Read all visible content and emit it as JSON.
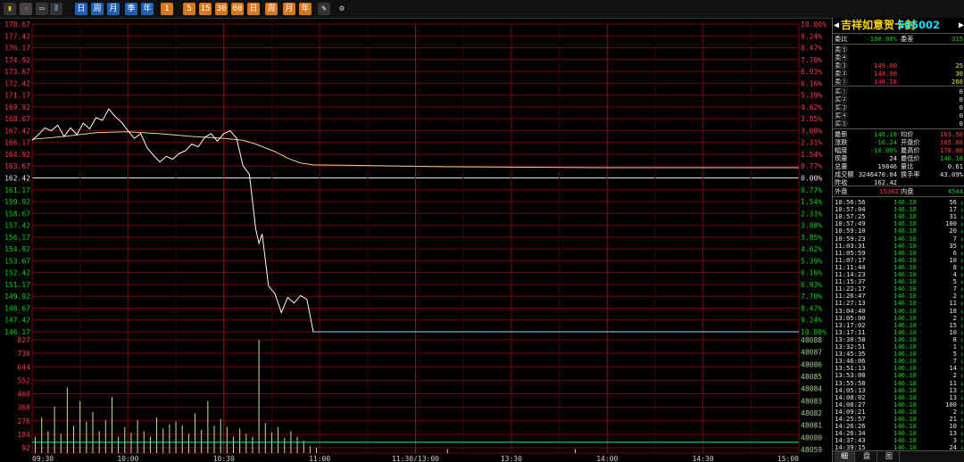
{
  "toolbar": {
    "buttons": [
      {
        "name": "bar-chart-icon",
        "glyph": "▮",
        "bg": "#333",
        "color": "#e8c000"
      },
      {
        "name": "line-chart-icon",
        "glyph": "↗",
        "bg": "#444",
        "color": "#ff4040"
      },
      {
        "name": "window-icon",
        "glyph": "▭",
        "bg": "#333",
        "color": "#ddd"
      },
      {
        "name": "candles-icon",
        "glyph": "⫴",
        "bg": "#333",
        "color": "#6cf"
      },
      {
        "name": "tool-1-icon",
        "glyph": "日",
        "bg": "#1e5fb8",
        "color": "#fff"
      },
      {
        "name": "tool-2-icon",
        "glyph": "周",
        "bg": "#1e5fb8",
        "color": "#fff"
      },
      {
        "name": "tool-3-icon",
        "glyph": "月",
        "bg": "#1e5fb8",
        "color": "#fff"
      },
      {
        "name": "tool-4-icon",
        "glyph": "季",
        "bg": "#1e5fb8",
        "color": "#fff"
      },
      {
        "name": "tool-5-icon",
        "glyph": "年",
        "bg": "#1e5fb8",
        "color": "#fff"
      },
      {
        "name": "period-1-icon",
        "glyph": "1",
        "bg": "#d9781a",
        "color": "#fff"
      },
      {
        "name": "period-5-icon",
        "glyph": "5",
        "bg": "#d9781a",
        "color": "#fff"
      },
      {
        "name": "period-15-icon",
        "glyph": "15",
        "bg": "#d9781a",
        "color": "#fff"
      },
      {
        "name": "period-30-icon",
        "glyph": "30",
        "bg": "#d9781a",
        "color": "#fff"
      },
      {
        "name": "period-60-icon",
        "glyph": "60",
        "bg": "#d9781a",
        "color": "#fff"
      },
      {
        "name": "period-d-icon",
        "glyph": "日",
        "bg": "#d9781a",
        "color": "#fff"
      },
      {
        "name": "period-w-icon",
        "glyph": "周",
        "bg": "#d9781a",
        "color": "#fff"
      },
      {
        "name": "period-m-icon",
        "glyph": "月",
        "bg": "#d9781a",
        "color": "#fff"
      },
      {
        "name": "period-y-icon",
        "glyph": "年",
        "bg": "#d9781a",
        "color": "#fff"
      },
      {
        "name": "draw-pen-icon",
        "glyph": "✎",
        "bg": "#333",
        "color": "#fff"
      },
      {
        "name": "gear-icon",
        "glyph": "⚙",
        "bg": "#111",
        "color": "#ddd"
      }
    ]
  },
  "colors": {
    "up": "#ff3b3b",
    "down": "#00d000",
    "flat": "#e6e6e6",
    "price_line": "#ffffff",
    "avg_line": "#e8d48a",
    "volume": "#b8e8a0",
    "grid": "#7a0000",
    "ref_line": "#00ff99"
  },
  "chart_data": [
    {
      "type": "line",
      "prev_close": 162.42,
      "price_ticks_left": [
        "178.67",
        "177.42",
        "176.17",
        "174.92",
        "173.67",
        "172.42",
        "171.17",
        "169.92",
        "168.67",
        "167.42",
        "166.17",
        "164.92",
        "163.67",
        "162.42",
        "161.17",
        "159.92",
        "158.67",
        "157.42",
        "156.17",
        "154.92",
        "153.67",
        "152.42",
        "151.17",
        "149.92",
        "148.67",
        "147.42",
        "146.17"
      ],
      "pct_ticks_right": [
        "10.00%",
        "9.24%",
        "8.47%",
        "7.70%",
        "6.93%",
        "6.16%",
        "5.39%",
        "4.62%",
        "3.85%",
        "3.08%",
        "2.31%",
        "1.54%",
        "0.77%",
        "0.00%",
        "0.77%",
        "1.54%",
        "2.31%",
        "3.08%",
        "3.85%",
        "4.62%",
        "5.39%",
        "6.16%",
        "6.93%",
        "7.70%",
        "8.47%",
        "9.24%",
        "10.00%"
      ],
      "ylim": [
        146.17,
        178.67
      ],
      "x_labels": [
        "09:30",
        "10:00",
        "10:30",
        "11:00",
        "11:30/13:00",
        "13:30",
        "14:00",
        "14:30",
        "15:00"
      ],
      "total_minutes": 240,
      "price": [
        [
          0,
          166.4
        ],
        [
          2,
          167
        ],
        [
          4,
          167.7
        ],
        [
          6,
          167.4
        ],
        [
          8,
          168
        ],
        [
          10,
          166.8
        ],
        [
          12,
          167.7
        ],
        [
          14,
          167
        ],
        [
          16,
          168.2
        ],
        [
          18,
          167.6
        ],
        [
          20,
          168.8
        ],
        [
          22,
          168.5
        ],
        [
          24,
          169.7
        ],
        [
          26,
          168.9
        ],
        [
          28,
          168.3
        ],
        [
          30,
          167.4
        ],
        [
          32,
          166.6
        ],
        [
          34,
          167.1
        ],
        [
          36,
          165.6
        ],
        [
          38,
          164.8
        ],
        [
          40,
          164.1
        ],
        [
          42,
          164.7
        ],
        [
          44,
          164.4
        ],
        [
          46,
          165
        ],
        [
          48,
          165.3
        ],
        [
          50,
          166
        ],
        [
          52,
          165.7
        ],
        [
          54,
          166.7
        ],
        [
          56,
          167.1
        ],
        [
          58,
          166.3
        ],
        [
          60,
          167.1
        ],
        [
          62,
          167.4
        ],
        [
          64,
          166.6
        ],
        [
          66,
          163.7
        ],
        [
          68,
          162.8
        ],
        [
          70,
          157
        ],
        [
          71,
          155.5
        ],
        [
          72,
          156.5
        ],
        [
          74,
          151
        ],
        [
          76,
          150.2
        ],
        [
          78,
          148.2
        ],
        [
          80,
          149.8
        ],
        [
          82,
          149.2
        ],
        [
          84,
          150
        ],
        [
          86,
          149.6
        ],
        [
          88,
          146.17
        ],
        [
          240,
          146.17
        ]
      ],
      "avg": [
        [
          0,
          166.5
        ],
        [
          10,
          166.8
        ],
        [
          20,
          167.2
        ],
        [
          30,
          167.3
        ],
        [
          40,
          167.1
        ],
        [
          50,
          166.8
        ],
        [
          60,
          166.6
        ],
        [
          66,
          166.4
        ],
        [
          70,
          166
        ],
        [
          76,
          165.2
        ],
        [
          80,
          164.5
        ],
        [
          84,
          164
        ],
        [
          88,
          163.8
        ],
        [
          100,
          163.75
        ],
        [
          130,
          163.6
        ],
        [
          180,
          163.5
        ],
        [
          240,
          163.5
        ]
      ]
    },
    {
      "type": "bar",
      "ylim": [
        0,
        827
      ],
      "vol_ticks_left": [
        "827",
        "736",
        "644",
        "552",
        "460",
        "368",
        "276",
        "184",
        "92"
      ],
      "vol_ticks_right": [
        "48088",
        "48087",
        "48086",
        "48085",
        "48084",
        "48083",
        "48082",
        "48081",
        "48080",
        "48059"
      ],
      "ref_level": 92,
      "volume": [
        [
          1,
          120
        ],
        [
          3,
          260
        ],
        [
          5,
          160
        ],
        [
          7,
          340
        ],
        [
          9,
          140
        ],
        [
          11,
          480
        ],
        [
          13,
          200
        ],
        [
          15,
          380
        ],
        [
          17,
          230
        ],
        [
          19,
          300
        ],
        [
          21,
          160
        ],
        [
          23,
          240
        ],
        [
          25,
          410
        ],
        [
          27,
          120
        ],
        [
          29,
          190
        ],
        [
          31,
          150
        ],
        [
          33,
          240
        ],
        [
          35,
          160
        ],
        [
          37,
          120
        ],
        [
          39,
          260
        ],
        [
          41,
          180
        ],
        [
          43,
          210
        ],
        [
          45,
          230
        ],
        [
          47,
          200
        ],
        [
          49,
          140
        ],
        [
          51,
          290
        ],
        [
          53,
          170
        ],
        [
          55,
          380
        ],
        [
          57,
          200
        ],
        [
          59,
          250
        ],
        [
          61,
          190
        ],
        [
          63,
          120
        ],
        [
          65,
          180
        ],
        [
          67,
          140
        ],
        [
          69,
          120
        ],
        [
          71,
          827
        ],
        [
          73,
          220
        ],
        [
          75,
          150
        ],
        [
          77,
          190
        ],
        [
          79,
          110
        ],
        [
          81,
          160
        ],
        [
          83,
          120
        ],
        [
          85,
          90
        ],
        [
          87,
          50
        ],
        [
          89,
          40
        ],
        [
          130,
          30
        ],
        [
          170,
          30
        ]
      ]
    }
  ],
  "quote": {
    "name": "吉祥如意贺卡封",
    "code": "505002",
    "weibi_label": "委比",
    "weibi_val": "-100.00%",
    "weicha_label": "委差",
    "weicha_val": "315",
    "asks": [
      {
        "label": "卖⑤",
        "price": "",
        "vol": ""
      },
      {
        "label": "卖④",
        "price": "",
        "vol": ""
      },
      {
        "label": "卖③",
        "price": "149.00",
        "vol": "25"
      },
      {
        "label": "卖②",
        "price": "148.90",
        "vol": "30"
      },
      {
        "label": "卖①",
        "price": "146.18",
        "vol": "260"
      }
    ],
    "bids": [
      {
        "label": "买①",
        "price": "",
        "vol": "0"
      },
      {
        "label": "买②",
        "price": "",
        "vol": "0"
      },
      {
        "label": "买③",
        "price": "",
        "vol": "0"
      },
      {
        "label": "买④",
        "price": "",
        "vol": "0"
      },
      {
        "label": "买⑤",
        "price": "",
        "vol": "0"
      }
    ],
    "stats": [
      {
        "l1": "最新",
        "v1": "146.18",
        "c1": "grn",
        "l2": "均价",
        "v2": "163.58",
        "c2": "red"
      },
      {
        "l1": "涨跌",
        "v1": "-16.24",
        "c1": "grn",
        "l2": "开盘价",
        "v2": "165.00",
        "c2": "red"
      },
      {
        "l1": "幅度",
        "v1": "-10.00%",
        "c1": "grn",
        "l2": "最高价",
        "v2": "170.00",
        "c2": "red"
      },
      {
        "l1": "现量",
        "v1": "24",
        "c1": "wht",
        "l2": "最低价",
        "v2": "146.18",
        "c2": "grn"
      },
      {
        "l1": "总量",
        "v1": "19846",
        "c1": "wht",
        "l2": "量比",
        "v2": "0.61",
        "c2": "wht"
      },
      {
        "l1": "成交额",
        "v1": "3246470.04",
        "c1": "wht",
        "l2": "换手率",
        "v2": "43.09%",
        "c2": "wht"
      },
      {
        "l1": "昨收",
        "v1": "162.42",
        "c1": "wht",
        "l2": "",
        "v2": "",
        "c2": "wht"
      }
    ],
    "outer_label": "外盘",
    "outer_val": "15302",
    "inner_label": "内盘",
    "inner_val": "4544",
    "ticks": [
      {
        "t": "10:56:56",
        "p": "146.18",
        "v": "56",
        "d": "↓"
      },
      {
        "t": "10:57:04",
        "p": "146.18",
        "v": "17",
        "d": "↓"
      },
      {
        "t": "10:57:25",
        "p": "146.18",
        "v": "31",
        "d": "↓"
      },
      {
        "t": "10:57:49",
        "p": "146.18",
        "v": "100",
        "d": "↓"
      },
      {
        "t": "10:59:10",
        "p": "146.18",
        "v": "20",
        "d": "↓"
      },
      {
        "t": "10:59:23",
        "p": "146.18",
        "v": "7",
        "d": "↓"
      },
      {
        "t": "11:03:31",
        "p": "146.18",
        "v": "35",
        "d": "↓"
      },
      {
        "t": "11:05:59",
        "p": "146.18",
        "v": "6",
        "d": "↓"
      },
      {
        "t": "11:07:17",
        "p": "146.18",
        "v": "10",
        "d": "↓"
      },
      {
        "t": "11:11:44",
        "p": "146.18",
        "v": "8",
        "d": "↓"
      },
      {
        "t": "11:14:23",
        "p": "146.18",
        "v": "4",
        "d": "↓"
      },
      {
        "t": "11:15:37",
        "p": "146.18",
        "v": "5",
        "d": "↓"
      },
      {
        "t": "11:22:17",
        "p": "146.18",
        "v": "7",
        "d": "↓"
      },
      {
        "t": "11:26:47",
        "p": "146.18",
        "v": "2",
        "d": "↓"
      },
      {
        "t": "11:27:13",
        "p": "146.18",
        "v": "11",
        "d": "↓"
      },
      {
        "t": "13:04:40",
        "p": "146.18",
        "v": "18",
        "d": "↓"
      },
      {
        "t": "13:05:00",
        "p": "146.18",
        "v": "2",
        "d": "↓"
      },
      {
        "t": "13:17:02",
        "p": "146.18",
        "v": "15",
        "d": "↓"
      },
      {
        "t": "13:17:11",
        "p": "146.18",
        "v": "10",
        "d": "↓"
      },
      {
        "t": "13:30:58",
        "p": "146.18",
        "v": "8",
        "d": "↓"
      },
      {
        "t": "13:32:51",
        "p": "146.18",
        "v": "1",
        "d": "↓"
      },
      {
        "t": "13:45:35",
        "p": "146.18",
        "v": "5",
        "d": "↓"
      },
      {
        "t": "13:46:06",
        "p": "146.18",
        "v": "7",
        "d": "↓"
      },
      {
        "t": "13:51:13",
        "p": "146.18",
        "v": "14",
        "d": "↓"
      },
      {
        "t": "13:53:08",
        "p": "146.18",
        "v": "2",
        "d": "↓"
      },
      {
        "t": "13:55:58",
        "p": "146.18",
        "v": "11",
        "d": "↓"
      },
      {
        "t": "14:05:13",
        "p": "146.18",
        "v": "13",
        "d": "↓"
      },
      {
        "t": "14:08:02",
        "p": "146.18",
        "v": "13",
        "d": "↓"
      },
      {
        "t": "14:08:27",
        "p": "146.18",
        "v": "100",
        "d": "↓"
      },
      {
        "t": "14:09:21",
        "p": "146.18",
        "v": "2",
        "d": "↓"
      },
      {
        "t": "14:25:57",
        "p": "146.18",
        "v": "21",
        "d": "↓"
      },
      {
        "t": "14:26:26",
        "p": "146.18",
        "v": "10",
        "d": "↓"
      },
      {
        "t": "14:26:34",
        "p": "146.18",
        "v": "13",
        "d": "↓"
      },
      {
        "t": "14:37:43",
        "p": "146.18",
        "v": "3",
        "d": "↓"
      },
      {
        "t": "14:39:15",
        "p": "146.18",
        "v": "24",
        "d": "↓"
      }
    ],
    "tabs": [
      "细",
      "盘",
      "图"
    ]
  }
}
